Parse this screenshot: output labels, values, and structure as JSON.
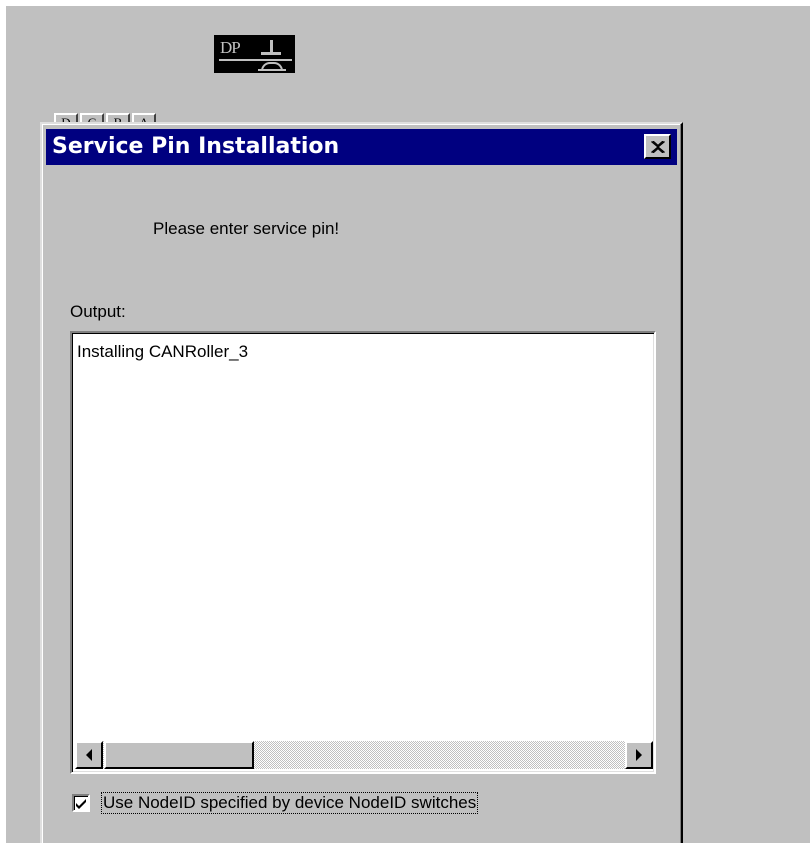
{
  "background_app": {
    "dp_icon": {
      "text": "DP",
      "icon": "service-pin-icon"
    },
    "toolbar_buttons": [
      "D",
      "C",
      "B",
      "A"
    ]
  },
  "dialog": {
    "title": "Service Pin Installation",
    "close_icon": "close-icon",
    "prompt": "Please enter service pin!",
    "output_label": "Output:",
    "output_lines": [
      "Installing CANRoller_3"
    ],
    "scroll_left_icon": "arrow-left-icon",
    "scroll_right_icon": "arrow-right-icon",
    "checkbox": {
      "checked": true,
      "label": "Use NodeID specified by device NodeID switches"
    }
  },
  "colors": {
    "title_bar": "#000080",
    "face": "#c0c0c0",
    "field": "#ffffff"
  }
}
